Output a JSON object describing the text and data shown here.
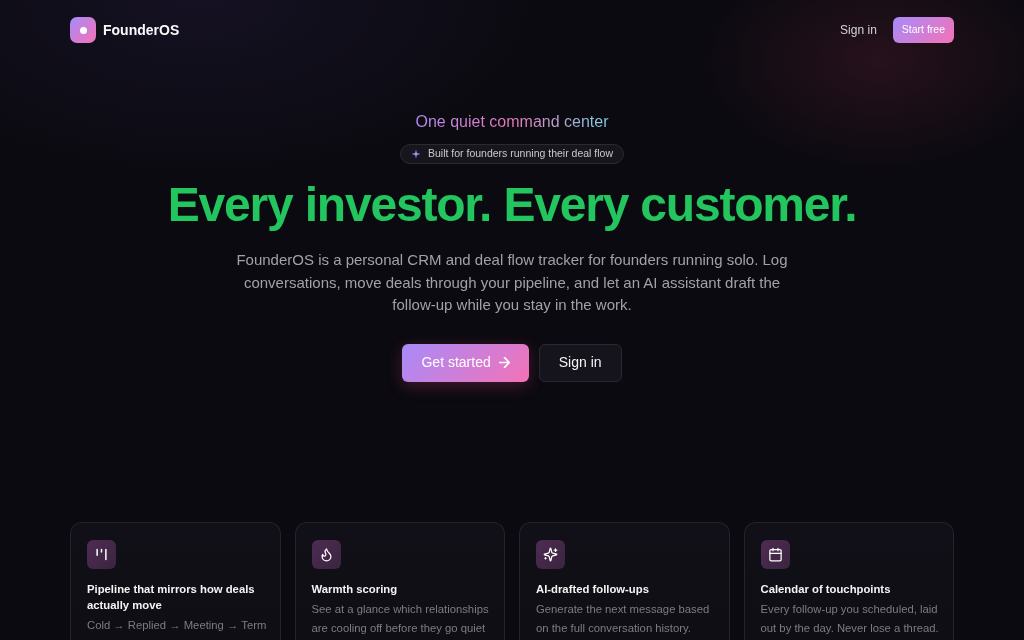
{
  "nav": {
    "brand": "FounderOS",
    "links": [
      {
        "label": "Sign in",
        "kind": "link"
      },
      {
        "label": "Start free",
        "kind": "button"
      }
    ]
  },
  "hero": {
    "tagline": "One quiet command center",
    "badge": "Built for founders running their deal flow",
    "headline": "Every investor. Every customer.",
    "description": "FounderOS is a personal CRM and deal flow tracker for founders running solo. Log conversations, move deals through your pipeline, and let an AI assistant draft the follow-up while you stay in the work.",
    "actions": [
      {
        "label": "Get started",
        "kind": "primary"
      },
      {
        "label": "Sign in",
        "kind": "secondary"
      }
    ]
  },
  "features": [
    {
      "title": "Pipeline that mirrors how deals actually move",
      "description": "Cold → Replied → Meeting → Term"
    },
    {
      "title": "Warmth scoring",
      "description": "See at a glance which relationships are cooling off before they go quiet"
    },
    {
      "title": "AI-drafted follow-ups",
      "description": "Generate the next message based on the full conversation history."
    },
    {
      "title": "Calendar of touchpoints",
      "description": "Every follow-up you scheduled, laid out by the day. Never lose a thread."
    }
  ]
}
